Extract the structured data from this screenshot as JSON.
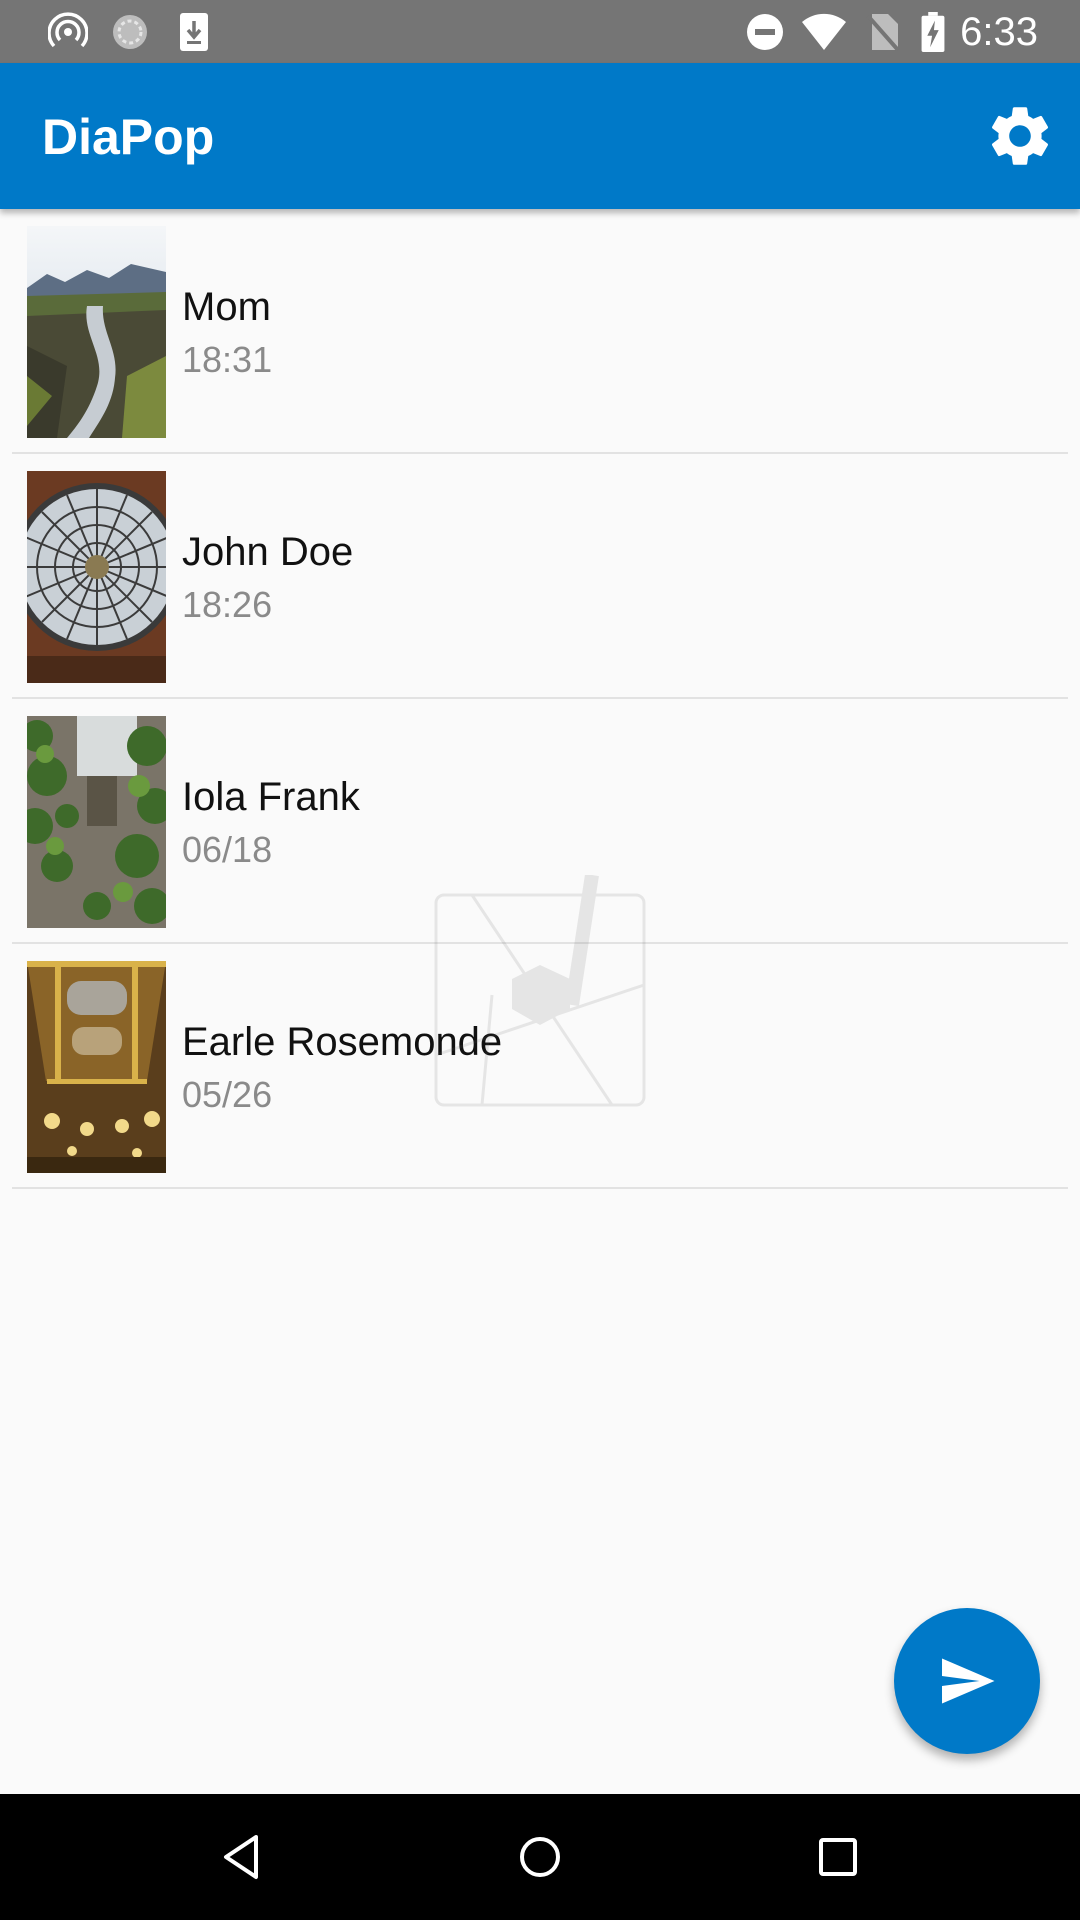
{
  "status_bar": {
    "time": "6:33",
    "left_icons": [
      "hotspot-icon",
      "sync-icon",
      "download-icon"
    ],
    "right_icons": [
      "do-not-disturb-icon",
      "wifi-icon",
      "no-sim-icon",
      "battery-charging-icon"
    ]
  },
  "app_bar": {
    "title": "DiaPop",
    "settings_icon": "gear-icon"
  },
  "conversations": [
    {
      "name": "Mom",
      "time": "18:31",
      "thumbnail": "mountain-river-photo"
    },
    {
      "name": "John Doe",
      "time": "18:26",
      "thumbnail": "glass-dome-photo"
    },
    {
      "name": "Iola Frank",
      "time": "06/18",
      "thumbnail": "ivy-stone-wall-photo"
    },
    {
      "name": "Earle Rosemonde",
      "time": "05/26",
      "thumbnail": "opera-ceiling-photo"
    }
  ],
  "fab": {
    "icon": "send-icon"
  },
  "nav_bar": {
    "icons": [
      "back-icon",
      "home-icon",
      "recents-icon"
    ]
  },
  "colors": {
    "primary": "#0079c8",
    "status_bar": "#757575",
    "background": "#fafafa",
    "secondary_text": "#8a8a8a"
  }
}
